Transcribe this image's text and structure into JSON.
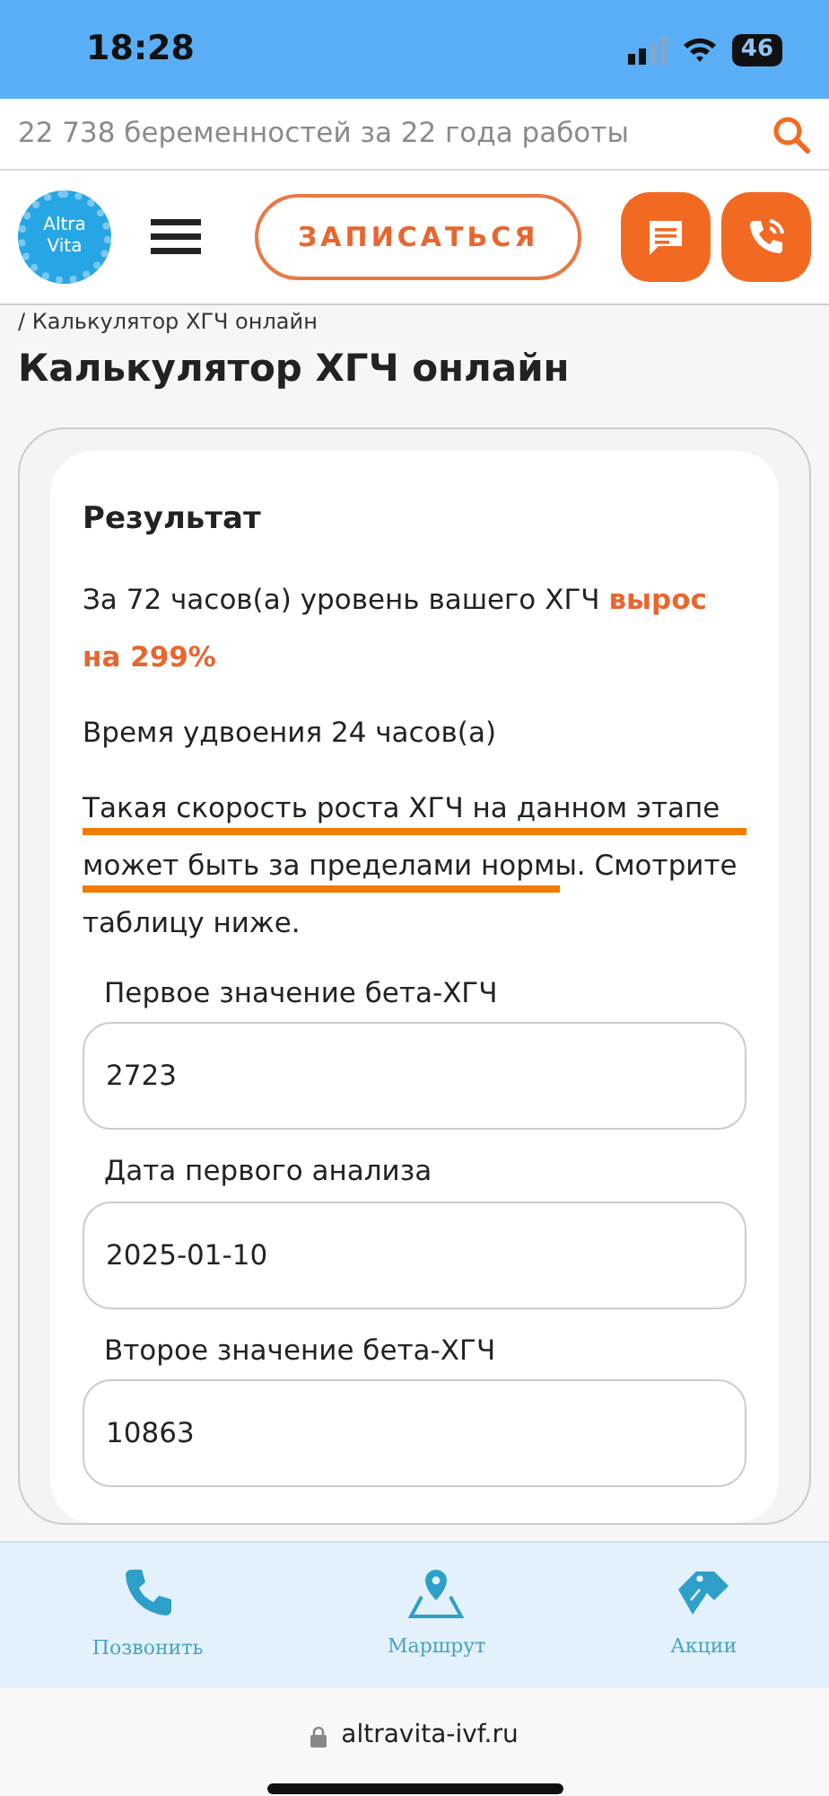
{
  "status_bar": {
    "time": "18:28",
    "battery": "46"
  },
  "promo_strip": {
    "text": "22 738 беременностей за 22 года работы"
  },
  "header": {
    "logo_words": [
      "Altra",
      "Vita"
    ],
    "cta": "ЗАПИСАТЬСЯ"
  },
  "breadcrumb": "/ Калькулятор ХГЧ онлайн",
  "page_title": "Калькулятор ХГЧ онлайн",
  "result": {
    "heading": "Результат",
    "paragraphs": [
      {
        "text": "За 72 часов(а) уровень вашего ХГЧ **вырос на 299%**",
        "hand_underlined": false
      },
      {
        "text": "Время удвоения 24 часов(а)",
        "hand_underlined": false
      },
      {
        "text": "Такая скорость роста ХГЧ на данном этапе может быть за пределами нормы. Смотрите таблицу ниже.",
        "hand_underlined": true
      }
    ]
  },
  "fields": [
    {
      "label": "Первое значение бета-ХГЧ",
      "value": "2723"
    },
    {
      "label": "Дата первого анализа",
      "value": "2025-01-10"
    },
    {
      "label": "Второе значение бета-ХГЧ",
      "value": "10863"
    }
  ],
  "bottom_nav": [
    {
      "kind": "phone",
      "label": "Позвонить"
    },
    {
      "kind": "route",
      "label": "Маршрут"
    },
    {
      "kind": "tag",
      "label": "Акции"
    }
  ],
  "address_bar": {
    "url": "altravita-ivf.ru"
  }
}
